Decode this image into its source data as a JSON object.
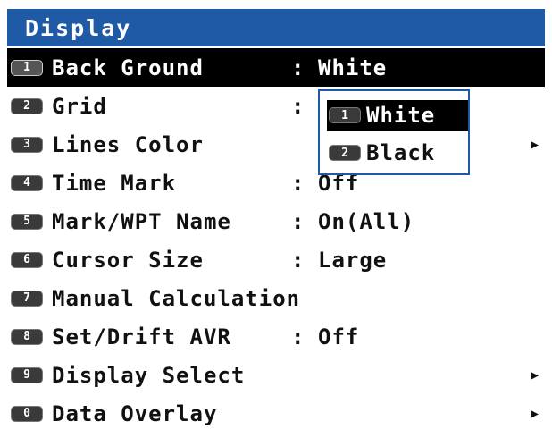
{
  "title": "Display",
  "menu": [
    {
      "key": "1",
      "label": "Back Ground",
      "colon": ":",
      "value": "White",
      "arrow": "",
      "selected": true
    },
    {
      "key": "2",
      "label": "Grid",
      "colon": ":",
      "value": "",
      "arrow": "",
      "selected": false
    },
    {
      "key": "3",
      "label": "Lines Color",
      "colon": "",
      "value": "",
      "arrow": "▶",
      "selected": false
    },
    {
      "key": "4",
      "label": "Time Mark",
      "colon": ":",
      "value": "Off",
      "arrow": "",
      "selected": false
    },
    {
      "key": "5",
      "label": "Mark/WPT Name",
      "colon": ":",
      "value": "On(All)",
      "arrow": "",
      "selected": false
    },
    {
      "key": "6",
      "label": "Cursor Size",
      "colon": ":",
      "value": "Large",
      "arrow": "",
      "selected": false
    },
    {
      "key": "7",
      "label": "Manual Calculation",
      "colon": "",
      "value": "",
      "arrow": "",
      "selected": false
    },
    {
      "key": "8",
      "label": "Set/Drift AVR",
      "colon": ":",
      "value": "Off",
      "arrow": "",
      "selected": false
    },
    {
      "key": "9",
      "label": "Display Select",
      "colon": "",
      "value": "",
      "arrow": "▶",
      "selected": false
    },
    {
      "key": "0",
      "label": "Data Overlay",
      "colon": "",
      "value": "",
      "arrow": "▶",
      "selected": false
    }
  ],
  "popup": {
    "options": [
      {
        "key": "1",
        "label": "White",
        "selected": true
      },
      {
        "key": "2",
        "label": "Black",
        "selected": false
      }
    ]
  },
  "colors": {
    "title_bar": "#1f5aa6",
    "highlight": "#000000",
    "popup_border": "#1f5aa6"
  }
}
